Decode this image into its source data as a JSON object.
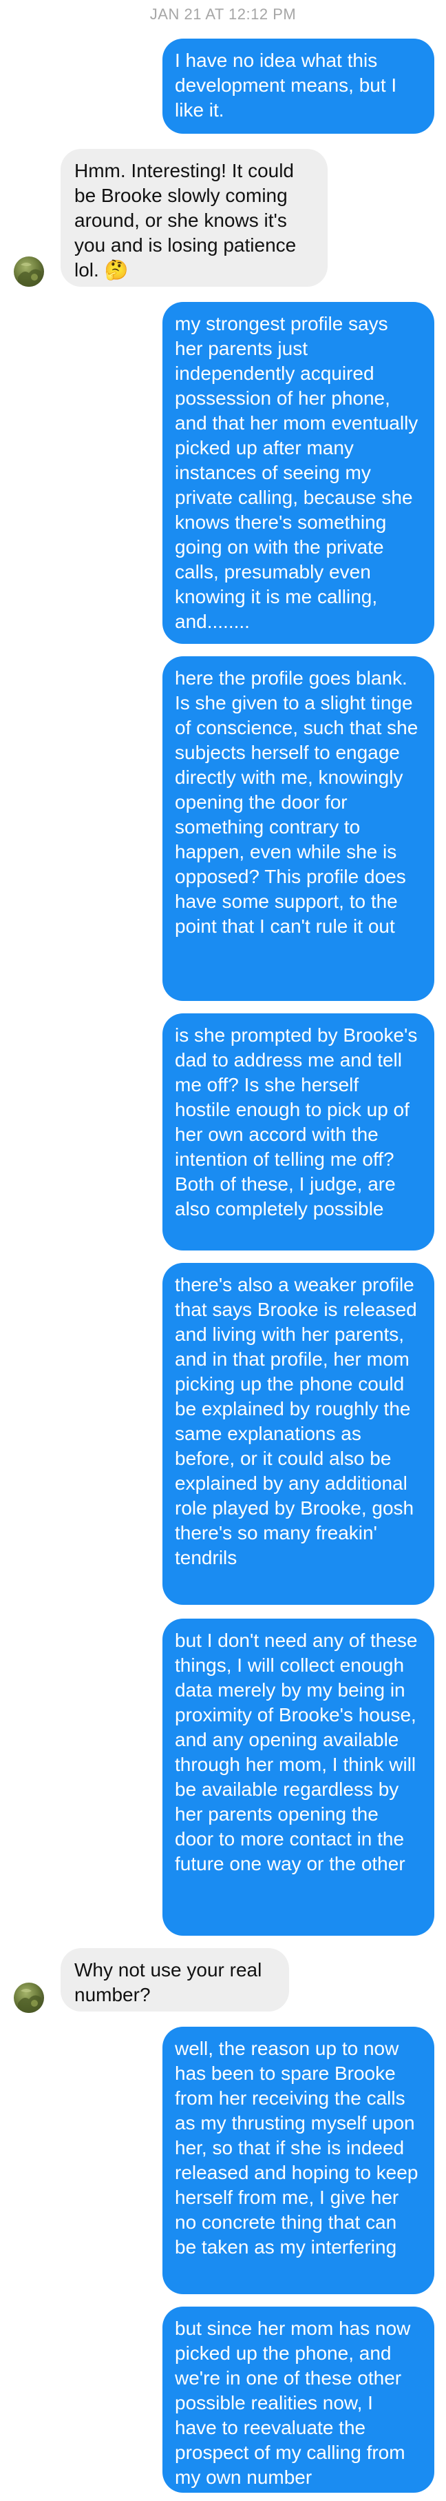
{
  "timestamp": "JAN 21 AT 12:12 PM",
  "contact_avatar_icon": "contact-avatar-photo-icon",
  "colors": {
    "outgoing_bubble": "#1a8cf2",
    "incoming_bubble": "#eeeeee",
    "timestamp_text": "#a6a6a6"
  },
  "messages": [
    {
      "sender": "me",
      "text": "I have no idea what this development means, but I like it."
    },
    {
      "sender": "contact",
      "text": "Hmm. Interesting! It could be Brooke slowly coming around, or she knows it's you and is losing patience lol. 🤔"
    },
    {
      "sender": "me",
      "text": "my strongest profile says her parents just independently acquired possession of her phone, and that her mom eventually picked up after many instances of seeing my private calling, because she knows there's something going on with the private calls, presumably even knowing it is me calling, and........"
    },
    {
      "sender": "me",
      "text": "here the profile goes blank. Is she given to a slight tinge of conscience, such that she subjects herself to engage directly with me, knowingly opening the door for something contrary to happen, even while she is opposed? This profile does have some support, to the point that I can't rule it out"
    },
    {
      "sender": "me",
      "text": "is she prompted by Brooke's dad to address me and tell me off? Is she herself hostile enough to pick up of her own accord with the intention of telling me off? Both of these, I judge, are also completely possible"
    },
    {
      "sender": "me",
      "text": "there's also a weaker profile that says Brooke is released and living with her parents, and in that profile, her mom picking up the phone could be explained by roughly the same explanations as before, or it could also be explained by any additional role played by Brooke, gosh there's so many freakin' tendrils"
    },
    {
      "sender": "me",
      "text": "but I don't need any of these things, I will collect enough data merely by my being in proximity of Brooke's house, and any opening available through her mom, I think will be available regardless by her parents opening the door to more contact in the future one way or the other"
    },
    {
      "sender": "contact",
      "text": "Why not use your real number?"
    },
    {
      "sender": "me",
      "text": "well, the reason up to now has been to spare Brooke from her receiving the calls as my thrusting myself upon her, so that if she is indeed released and hoping to keep herself from me, I give her no concrete thing that can be taken as my interfering"
    },
    {
      "sender": "me",
      "text": "but since her mom has now picked up the phone, and we're in one of these other possible realities now, I have to reevaluate the prospect of my calling from my own number"
    }
  ]
}
